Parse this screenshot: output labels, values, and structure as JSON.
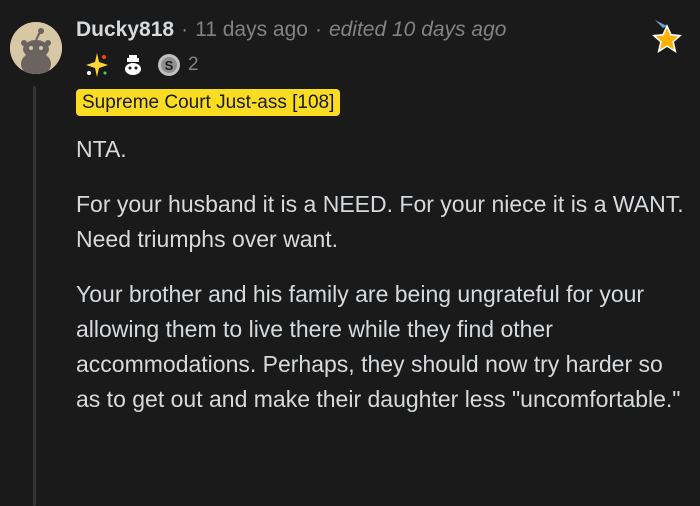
{
  "comment": {
    "username": "Ducky818",
    "separator": "·",
    "timestamp": "11 days ago",
    "edited": "edited 10 days ago",
    "award_count": "2",
    "flair": "Supreme Court Just-ass [108]",
    "paragraphs": [
      "NTA.",
      "For your husband it is a NEED. For your niece it is a WANT. Need triumphs over want.",
      "Your brother and his family are being ungrateful for your allowing them to live there while they find other accommodations. Perhaps, they should now try harder so as to get out and make their daughter less \"uncomfortable.\""
    ]
  },
  "icons": [
    "avatar-snoo",
    "sparkle-award-icon",
    "snoo-award-icon",
    "silver-award-icon",
    "star-award-icon"
  ],
  "colors": {
    "background": "#1a1a1b",
    "text": "#d7dadc",
    "muted": "#818384",
    "flair_bg": "#fadc23",
    "flair_text": "#1a1a1b"
  }
}
